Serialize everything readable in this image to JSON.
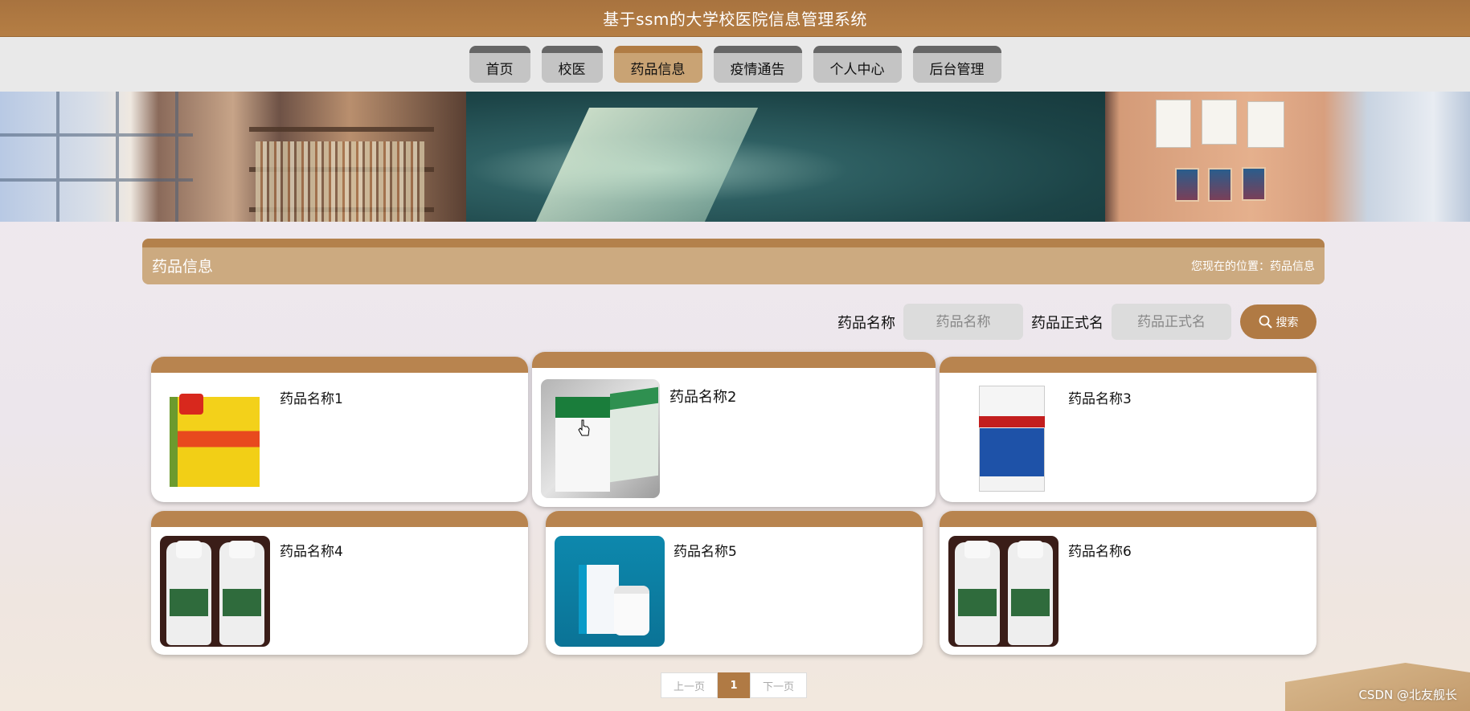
{
  "app": {
    "title": "基于ssm的大学校医院信息管理系统"
  },
  "nav": {
    "items": [
      {
        "label": "首页",
        "active": false
      },
      {
        "label": "校医",
        "active": false
      },
      {
        "label": "药品信息",
        "active": true
      },
      {
        "label": "疫情通告",
        "active": false
      },
      {
        "label": "个人中心",
        "active": false
      },
      {
        "label": "后台管理",
        "active": false
      }
    ]
  },
  "section": {
    "title": "药品信息",
    "breadcrumb": "您现在的位置：药品信息"
  },
  "search": {
    "field1_label": "药品名称",
    "field1_placeholder": "药品名称",
    "field2_label": "药品正式名",
    "field2_placeholder": "药品正式名",
    "button_label": "搜索",
    "button_icon": "search-icon"
  },
  "products": [
    {
      "name": "药品名称1"
    },
    {
      "name": "药品名称2"
    },
    {
      "name": "药品名称3"
    },
    {
      "name": "药品名称4"
    },
    {
      "name": "药品名称5"
    },
    {
      "name": "药品名称6"
    }
  ],
  "pagination": {
    "prev_label": "上一页",
    "current_page": "1",
    "next_label": "下一页"
  },
  "watermark": "CSDN @北友舰长",
  "colors": {
    "accent": "#b07a44",
    "card_cap": "#b8844f",
    "nav_active": "#c9a374"
  }
}
